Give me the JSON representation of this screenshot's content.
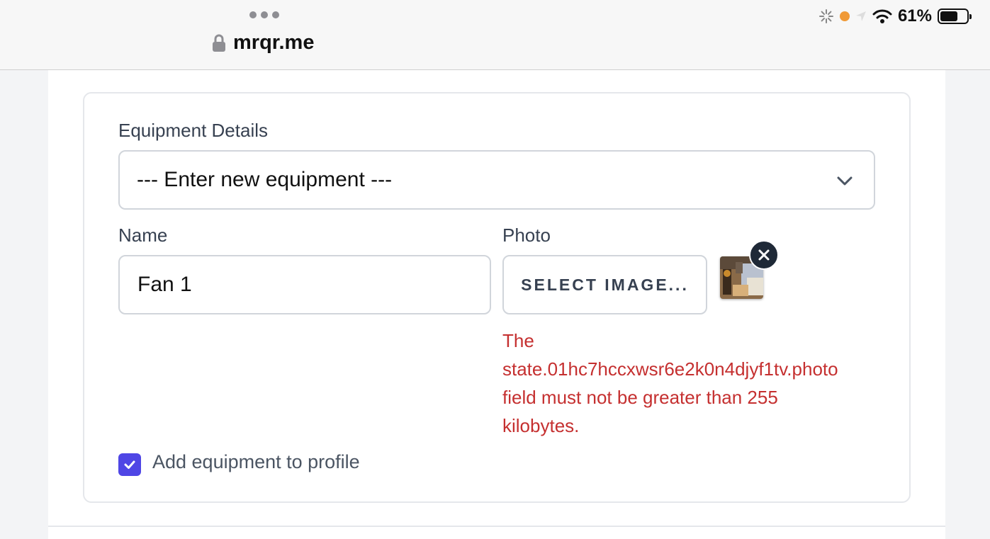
{
  "browser": {
    "url": "mrqr.me",
    "battery_percent": "61%"
  },
  "form": {
    "equipment_details_label": "Equipment Details",
    "equipment_select_value": "--- Enter new equipment ---",
    "name_label": "Name",
    "name_value": "Fan 1",
    "photo_label": "Photo",
    "select_image_button": "SELECT IMAGE...",
    "error_lines": [
      "The",
      "state.01hc7hccxwsr6e2k0n4djyf1tv.photo",
      "field must not be greater than 255",
      "kilobytes."
    ],
    "add_to_profile_label": "Add equipment to profile",
    "add_to_profile_checked": true
  },
  "colors": {
    "error": "#c53030",
    "checkbox": "#4f46e5",
    "remove_button": "#1f2937"
  },
  "icons": {
    "lock": "lock-icon",
    "chevron": "chevron-down-icon",
    "remove": "close-icon",
    "check": "check-icon"
  }
}
